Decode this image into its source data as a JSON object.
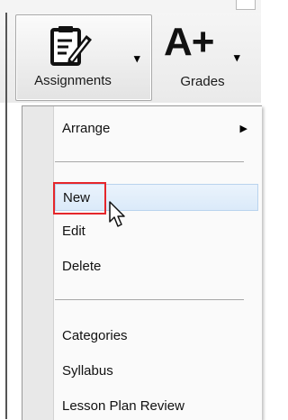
{
  "ribbon": {
    "assignments": {
      "label": "Assignments",
      "icon": "clipboard-edit-icon",
      "dropdown_caret": "▾"
    },
    "grades": {
      "label": "Grades",
      "icon_text": "A+",
      "dropdown_caret": "▾"
    }
  },
  "menu": {
    "submenu_arrow": "▶",
    "items": [
      {
        "label": "Arrange",
        "has_submenu": true
      },
      {
        "label": "New",
        "hovered": true,
        "highlighted": true
      },
      {
        "label": "Edit"
      },
      {
        "label": "Delete"
      },
      {
        "label": "Categories"
      },
      {
        "label": "Syllabus"
      },
      {
        "label": "Lesson Plan Review"
      }
    ]
  },
  "colors": {
    "highlight": "#e5262b",
    "hover": "#dbeaf9"
  }
}
